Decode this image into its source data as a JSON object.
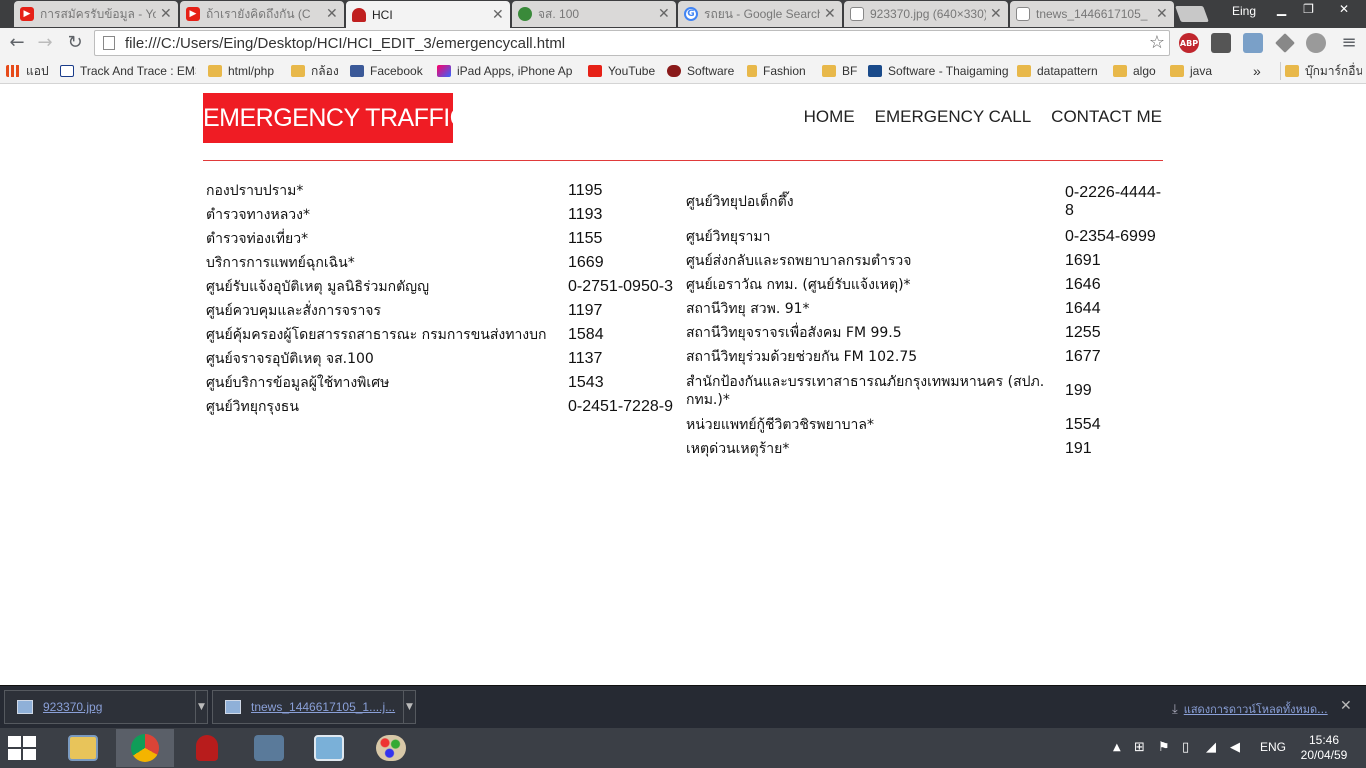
{
  "browser": {
    "tabs": [
      {
        "title": "การสมัครรับข้อมูล - You",
        "icon": "youtube-icon"
      },
      {
        "title": "ถ้าเรายังคิดถึงกัน (C",
        "icon": "youtube-icon"
      },
      {
        "title": "HCI",
        "icon": "hci-favicon"
      },
      {
        "title": "จส. 100",
        "icon": "js100-favicon"
      },
      {
        "title": "รถยน - Google Search",
        "icon": "google-icon"
      },
      {
        "title": "923370.jpg (640×330)",
        "icon": "page-icon"
      },
      {
        "title": "tnews_1446617105_",
        "icon": "page-icon"
      }
    ],
    "user": "Eing",
    "url": "file:///C:/Users/Eing/Desktop/HCI/HCI_EDIT_3/emergencycall.html",
    "extensions": [
      "ABP"
    ],
    "bookmarks": [
      {
        "label": "แอป",
        "icon": "apps-icon"
      },
      {
        "label": "Track And Trace : EMS",
        "icon": "ems-icon"
      },
      {
        "label": "html/php",
        "icon": "folder-icon"
      },
      {
        "label": "กล้อง",
        "icon": "folder-icon"
      },
      {
        "label": "Facebook",
        "icon": "facebook-icon"
      },
      {
        "label": "iPad Apps, iPhone Ap",
        "icon": "ipad-icon"
      },
      {
        "label": "YouTube",
        "icon": "youtube-icon"
      },
      {
        "label": "Software",
        "icon": "software-icon"
      },
      {
        "label": "Fashion",
        "icon": "lock-icon"
      },
      {
        "label": "BF",
        "icon": "folder-icon"
      },
      {
        "label": "Software - Thaigaming",
        "icon": "thaigaming-icon"
      },
      {
        "label": "datapattern",
        "icon": "folder-icon"
      },
      {
        "label": "algo",
        "icon": "folder-icon"
      },
      {
        "label": "java",
        "icon": "folder-icon"
      }
    ],
    "more_bookmarks": "บุ๊กมาร์กอื่นๆ"
  },
  "site": {
    "logo": "EMERGENCY TRAFFIC",
    "nav": [
      "HOME",
      "EMERGENCY CALL",
      "CONTACT ME"
    ],
    "left_list": [
      {
        "name": "กองปราบปราม*",
        "number": "1195"
      },
      {
        "name": "ตำรวจทางหลวง*",
        "number": "1193"
      },
      {
        "name": "ตำรวจท่องเที่ยว*",
        "number": "1155"
      },
      {
        "name": "บริการการแพทย์ฉุกเฉิน*",
        "number": "1669"
      },
      {
        "name": "ศูนย์รับแจ้งอุบัติเหตุ มูลนิธิร่วมกตัญญู",
        "number": "0-2751-0950-3"
      },
      {
        "name": "ศูนย์ควบคุมและสั่งการจราจร",
        "number": "1197"
      },
      {
        "name": "ศูนย์คุ้มครองผู้โดยสารรถสาธารณะ กรมการขนส่งทางบก",
        "number": "1584"
      },
      {
        "name": "ศูนย์จราจรอุบัติเหตุ จส.100",
        "number": "1137"
      },
      {
        "name": "ศูนย์บริการข้อมูลผู้ใช้ทางพิเศษ",
        "number": "1543"
      },
      {
        "name": "ศูนย์วิทยุกรุงธน",
        "number": "0-2451-7228-9"
      }
    ],
    "right_list": [
      {
        "name": "ศูนย์วิทยุปอเต็กตึ๊ง",
        "number": "0-2226-4444-8"
      },
      {
        "name": "ศูนย์วิทยุรามา",
        "number": "0-2354-6999"
      },
      {
        "name": "ศูนย์ส่งกลับและรถพยาบาลกรมตำรวจ",
        "number": "1691"
      },
      {
        "name": "ศูนย์เอราวัณ กทม. (ศูนย์รับแจ้งเหตุ)*",
        "number": "1646"
      },
      {
        "name": "สถานีวิทยุ สวพ. 91*",
        "number": "1644"
      },
      {
        "name": "สถานีวิทยุจราจรเพื่อสังคม FM 99.5",
        "number": "1255"
      },
      {
        "name": "สถานีวิทยุร่วมด้วยช่วยกัน FM 102.75",
        "number": "1677"
      },
      {
        "name": "สำนักป้องกันและบรรเทาสาธารณภัยกรุงเทพมหานคร (สปภ. กทม.)*",
        "number": "199"
      },
      {
        "name": "หน่วยแพทย์กู้ชีวิตวชิรพยาบาล*",
        "number": "1554"
      },
      {
        "name": "เหตุด่วนเหตุร้าย*",
        "number": "191"
      }
    ]
  },
  "downloads": {
    "items": [
      "923370.jpg",
      "tnews_1446617105_1....j..."
    ],
    "show_all": "แสดงการดาวน์โหลดทั้งหมด..."
  },
  "taskbar": {
    "language": "ENG",
    "time": "15:46",
    "date": "20/04/59"
  },
  "colors": {
    "logo_bg": "#ef1c24",
    "divider": "#e03a3a",
    "tabstrip": "#3d3e40",
    "taskbar": "#3b3f46"
  }
}
